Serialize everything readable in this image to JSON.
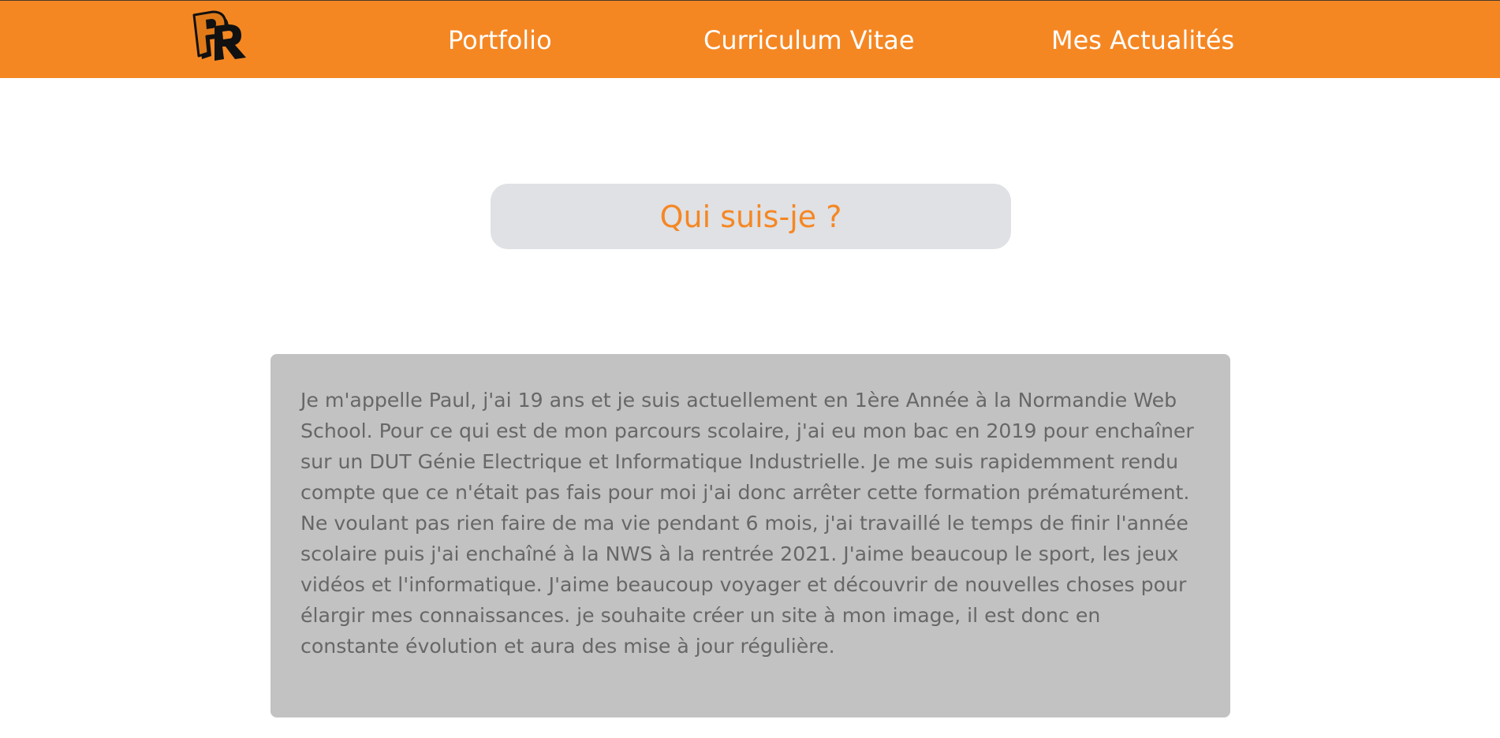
{
  "header": {
    "logo_alt": "PR",
    "nav": [
      {
        "label": "Portfolio"
      },
      {
        "label": "Curriculum Vitae"
      },
      {
        "label": "Mes Actualités"
      }
    ]
  },
  "main": {
    "title": "Qui suis-je ?",
    "bio": "Je m'appelle Paul, j'ai 19 ans et je suis actuellement en 1ère Année à la Normandie Web School. Pour ce qui est de mon parcours scolaire, j'ai eu mon bac en 2019 pour enchaîner sur un DUT Génie Electrique et Informatique Industrielle. Je me suis rapidemment rendu compte que ce n'était pas fais pour moi j'ai donc arrêter cette formation prématurément. Ne voulant pas rien faire de ma vie pendant 6 mois, j'ai travaillé le temps de finir l'année scolaire puis j'ai enchaîné à la NWS à la rentrée 2021. J'aime beaucoup le sport, les jeux vidéos et l'informatique. J'aime beaucoup voyager et découvrir de nouvelles choses pour élargir mes connaissances. je souhaite créer un site à mon image, il est donc en constante évolution et aura des mise à jour régulière."
  },
  "colors": {
    "brand_orange": "#f58723",
    "title_box_bg": "#dfe1e5",
    "bio_box_bg": "#c2c2c2",
    "bio_text": "#676767"
  }
}
